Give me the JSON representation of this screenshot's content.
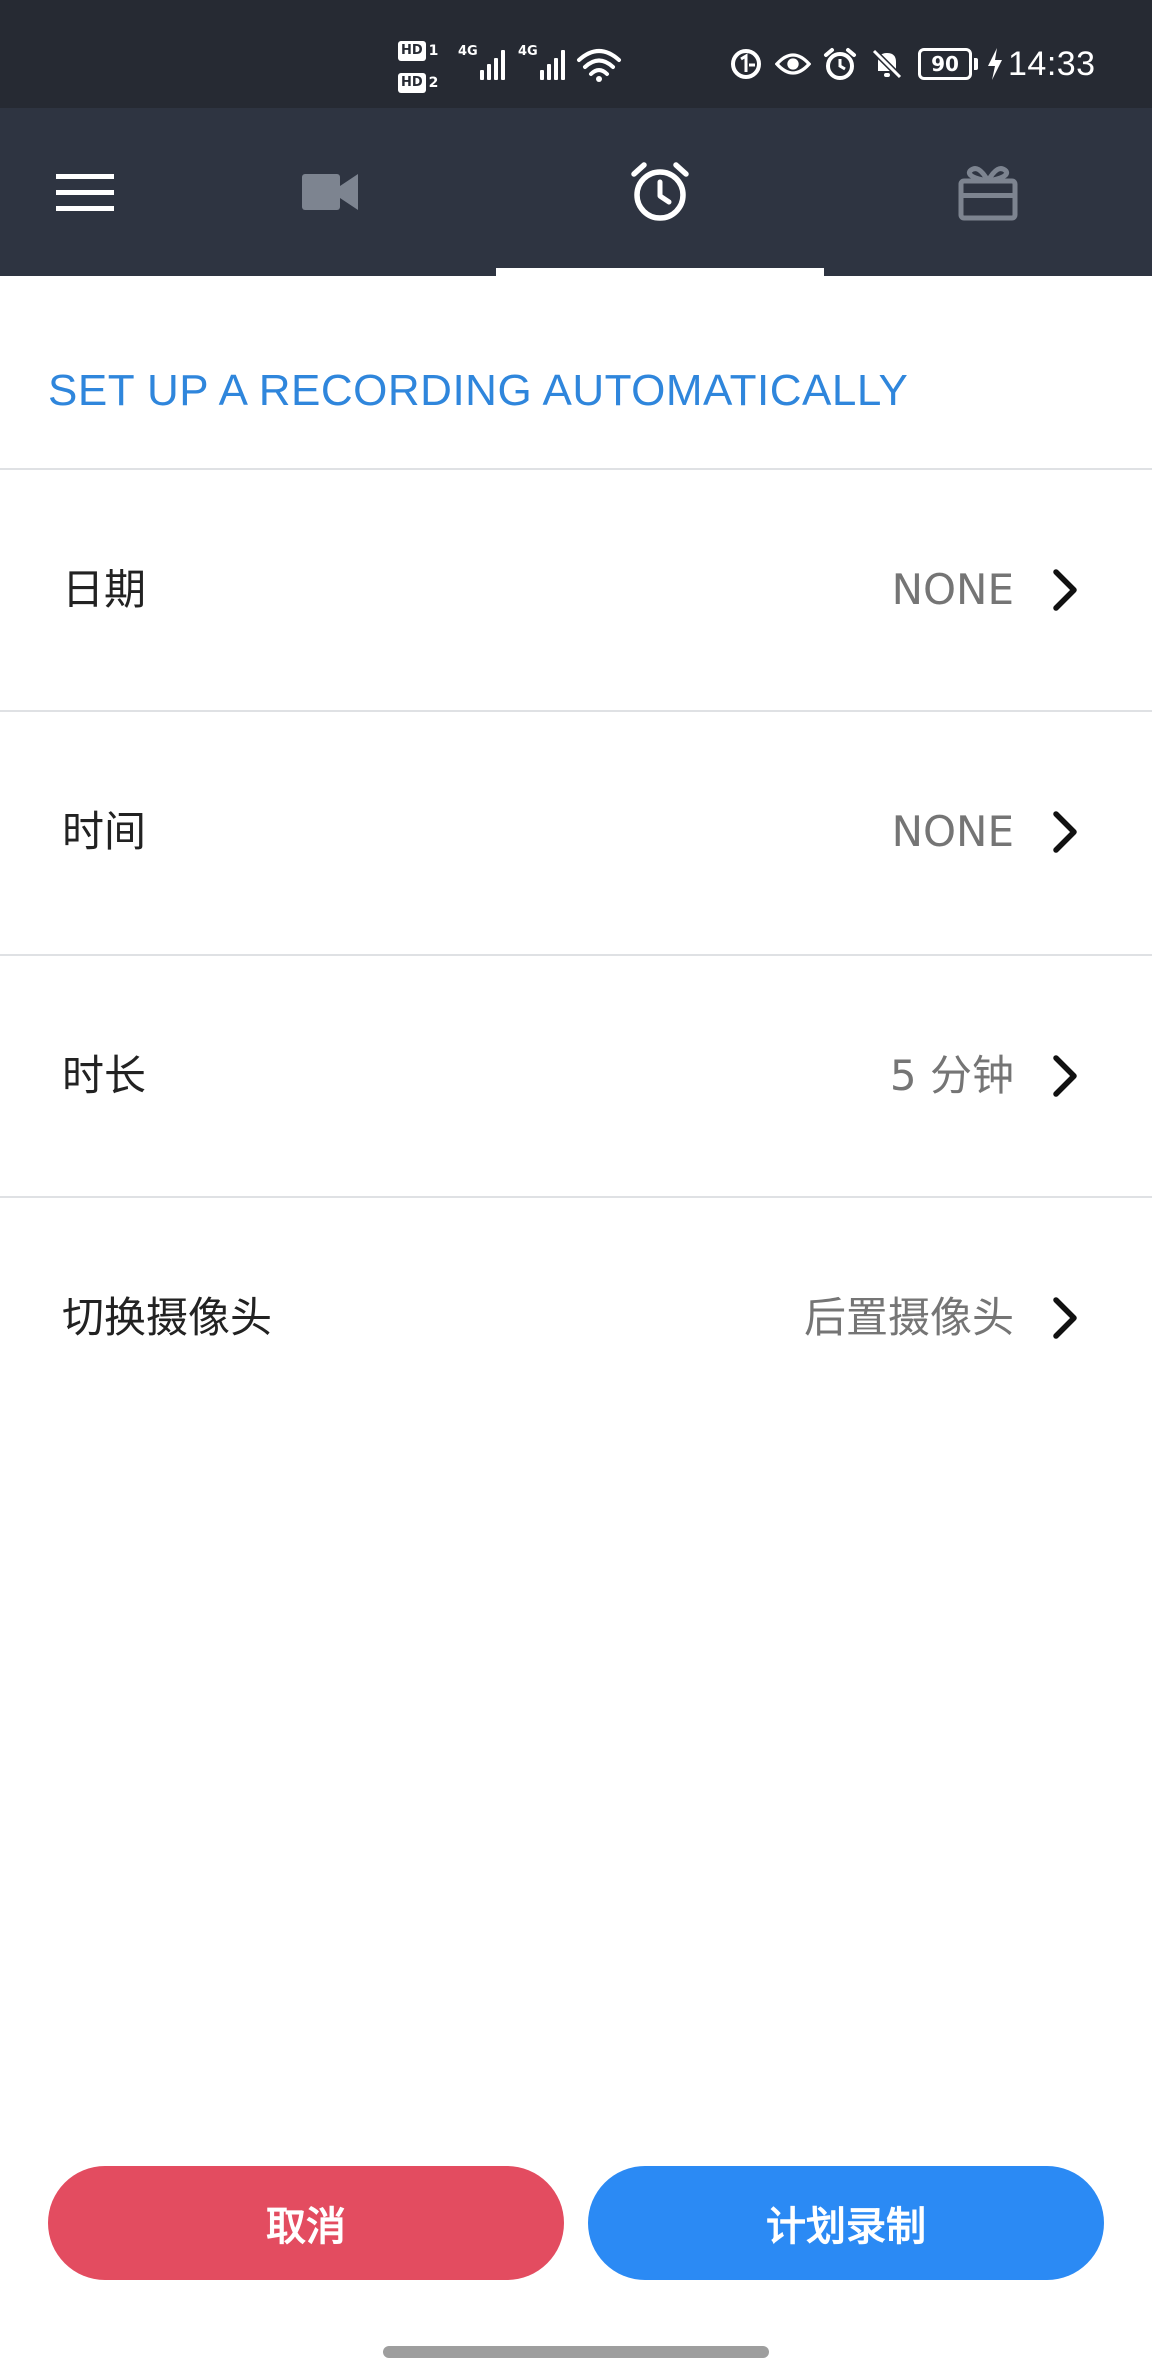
{
  "status_bar": {
    "sim1_hd": "HD",
    "sim1_no": "1",
    "sim2_hd": "HD",
    "sim2_no": "2",
    "signal1_gen": "4G",
    "signal2_gen": "4G",
    "battery": "90",
    "time": "14:33",
    "icons": [
      "hd-sim-icon",
      "signal-icon",
      "wifi-icon",
      "data-saver-icon",
      "eye-comfort-icon",
      "alarm-icon",
      "mute-icon",
      "battery-icon",
      "charging-icon"
    ]
  },
  "tabs": {
    "items": [
      {
        "icon": "menu-icon",
        "active": false
      },
      {
        "icon": "video-camera-icon",
        "active": false
      },
      {
        "icon": "alarm-clock-icon",
        "active": true
      },
      {
        "icon": "gift-icon",
        "active": false
      }
    ]
  },
  "section": {
    "title": "SET UP A RECORDING AUTOMATICALLY"
  },
  "rows": [
    {
      "label": "日期",
      "value": "NONE"
    },
    {
      "label": "时间",
      "value": "NONE"
    },
    {
      "label": "时长",
      "value": "5 分钟"
    },
    {
      "label": "切换摄像头",
      "value": "后置摄像头"
    }
  ],
  "buttons": {
    "cancel": "取消",
    "schedule": "计划录制"
  },
  "colors": {
    "accent_blue": "#2f86dc",
    "cancel_red": "#e34c60",
    "schedule_blue": "#2b8af4",
    "tabbar_bg": "#2e3441",
    "statusbar_bg": "#262a33"
  }
}
